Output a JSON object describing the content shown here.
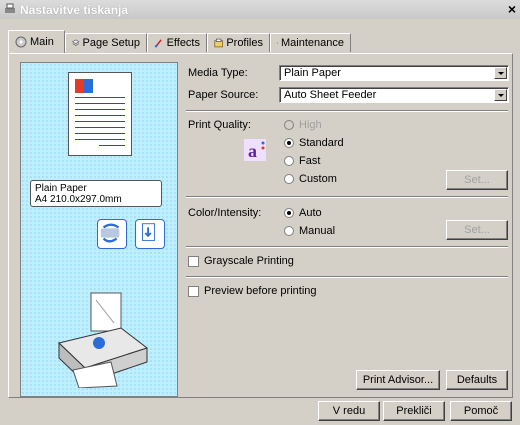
{
  "window": {
    "title": "Nastavitve tiskanja",
    "close_glyph": "×"
  },
  "tabs": [
    {
      "label": "Main",
      "icon": "disc-icon"
    },
    {
      "label": "Page Setup",
      "icon": "page-setup-icon"
    },
    {
      "label": "Effects",
      "icon": "effects-brush-icon"
    },
    {
      "label": "Profiles",
      "icon": "profiles-icon"
    },
    {
      "label": "Maintenance",
      "icon": "maintenance-icon"
    }
  ],
  "preview": {
    "media_line": "Plain Paper",
    "size_line": "A4 210.0x297.0mm"
  },
  "media_type": {
    "label": "Media Type:",
    "value": "Plain Paper"
  },
  "paper_source": {
    "label": "Paper Source:",
    "value": "Auto Sheet Feeder"
  },
  "print_quality": {
    "label": "Print Quality:",
    "options": [
      "High",
      "Standard",
      "Fast",
      "Custom"
    ],
    "selected": "Standard",
    "set_label": "Set..."
  },
  "color_intensity": {
    "label": "Color/Intensity:",
    "options": [
      "Auto",
      "Manual"
    ],
    "selected": "Auto",
    "set_label": "Set..."
  },
  "grayscale": {
    "label": "Grayscale Printing",
    "checked": false
  },
  "preview_before": {
    "label": "Preview before printing",
    "checked": false
  },
  "buttons": {
    "print_advisor": "Print Advisor...",
    "defaults": "Defaults"
  },
  "footer": {
    "ok": "V redu",
    "cancel": "Prekliči",
    "help": "Pomoč"
  }
}
